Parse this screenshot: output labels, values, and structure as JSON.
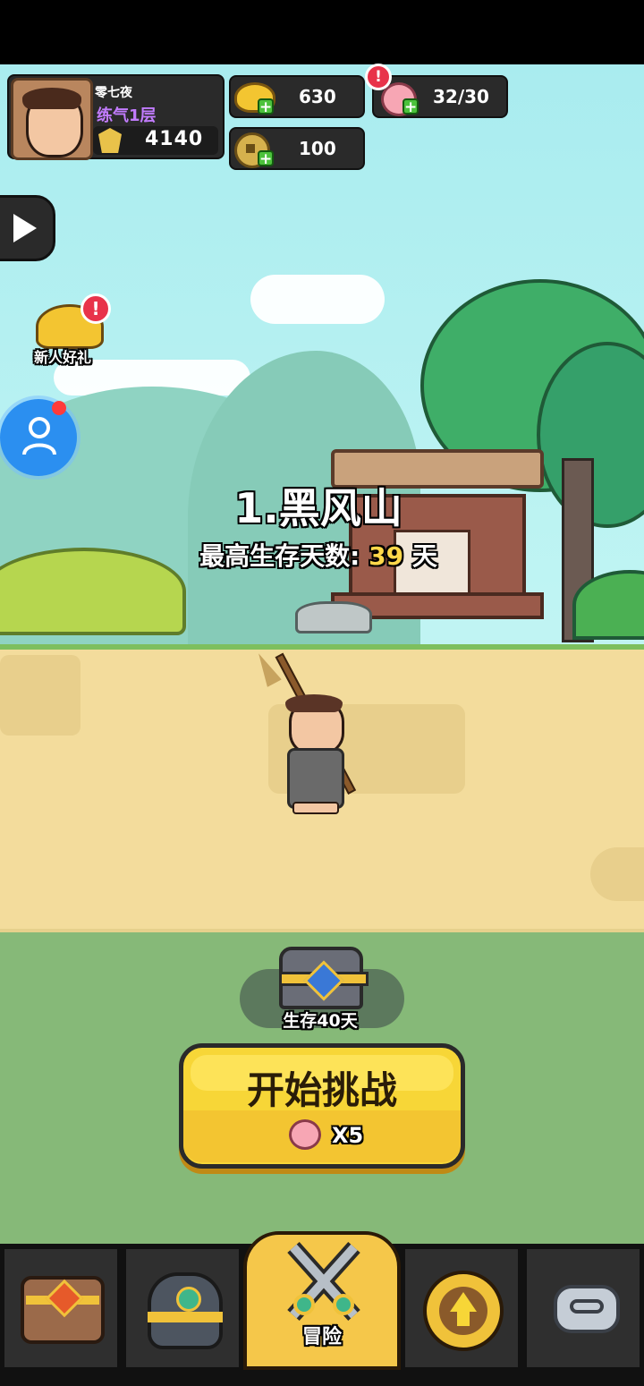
{
  "player": {
    "name": "零七夜",
    "realm": "练气1层",
    "power": "4140"
  },
  "currencies": {
    "gold": "630",
    "peach": "32/30",
    "coin": "100"
  },
  "side": {
    "newbie_gift": "新人好礼"
  },
  "stage": {
    "title": "1.黑风山",
    "best_label": "最高生存天数:",
    "best_days": "39",
    "best_unit": "天"
  },
  "reward": {
    "label": "生存40天"
  },
  "start_button": {
    "label": "开始挑战",
    "cost": "X5"
  },
  "nav": {
    "tabs": [
      {
        "icon": "treasure-chest-icon",
        "label": ""
      },
      {
        "icon": "helmet-icon",
        "label": ""
      },
      {
        "icon": "crossed-swords-icon",
        "label": "冒险"
      },
      {
        "icon": "upgrade-arrow-icon",
        "label": ""
      },
      {
        "icon": "cloud-emblem-icon",
        "label": ""
      }
    ]
  },
  "colors": {
    "realm": "#c27cff",
    "best_days": "#ffd84a",
    "button_yellow": "#f7d637",
    "nav_active": "#f5c74a"
  }
}
